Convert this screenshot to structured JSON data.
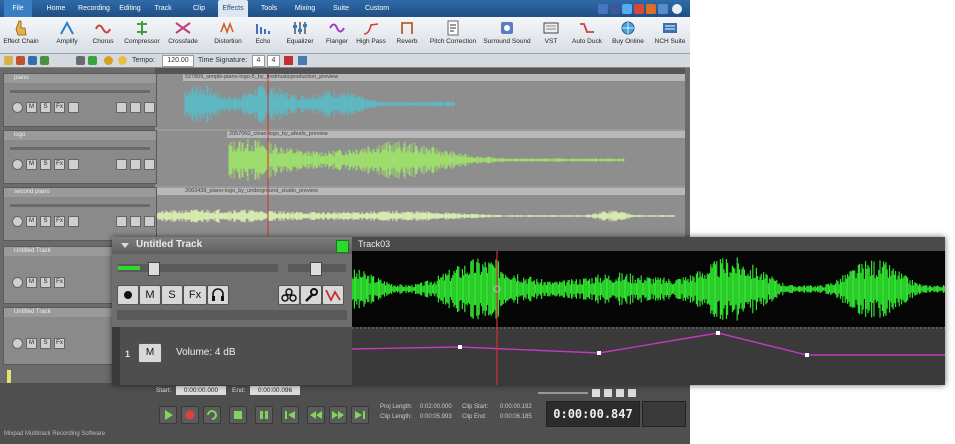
{
  "menu": [
    "File",
    "Home",
    "Recording",
    "Editing",
    "Track",
    "Clip",
    "Effects",
    "Tools",
    "Mixing",
    "Suite",
    "Custom"
  ],
  "ribbon": [
    "Effect Chain",
    "Amplify",
    "Chorus",
    "Compressor",
    "Crossfade",
    "Distortion",
    "Echo",
    "Equalizer",
    "Flanger",
    "High Pass",
    "Reverb",
    "Pitch Correction",
    "Surround Sound",
    "VST",
    "Auto Duck",
    "Buy Online",
    "NCH Suite"
  ],
  "toolbar": {
    "tempo_label": "Tempo:",
    "tempo_value": "120.00",
    "timesig_label": "Time Signature:",
    "timesig_num": "4",
    "timesig_den": "4"
  },
  "tracks": [
    {
      "name": "piano",
      "clip": "527809_simple-piano-logo-5_by_fredmusicproduction_preview"
    },
    {
      "name": "logo",
      "clip": "2057060_clean-logo_by_afeafx_preview"
    },
    {
      "name": "second piano",
      "clip": "2063438_piano-logo_by_underground_studio_preview"
    },
    {
      "name": "Untitled Track",
      "clip": ""
    },
    {
      "name": "Untitled Track",
      "clip": ""
    }
  ],
  "track_buttons": [
    "M",
    "S",
    "Fx"
  ],
  "zoom": {
    "track_title": "Untitled Track",
    "clip_title": "Track03",
    "lane_index": "1",
    "mute": "M",
    "volume": "Volume: 4 dB",
    "buttons": [
      "M",
      "S",
      "Fx"
    ]
  },
  "bottom": {
    "start_label": "Start:",
    "start_value": "0:00:00.000",
    "end_label": "End:",
    "end_value": "0:00:00.096",
    "proj_length_label": "Proj Length:",
    "proj_length": "0:02:00.000",
    "clip_length_label": "Clip Length:",
    "clip_length": "0:00:05.993",
    "clip_start_label": "Clip Start:",
    "clip_start": "0:00:00.192",
    "clip_end_label": "Clip End:",
    "clip_end": "0:00:06.185",
    "time": "0:00:00.847",
    "status": "Mixpad Multitrack Recording Software"
  },
  "colors": {
    "wave_teal": "#5fb7c2",
    "wave_green": "#9fdc6e",
    "wave_pale": "#d6eab0",
    "zoom_wave": "#2fe02f",
    "envelope": "#c03bc0",
    "playhead": "#cc3333"
  }
}
